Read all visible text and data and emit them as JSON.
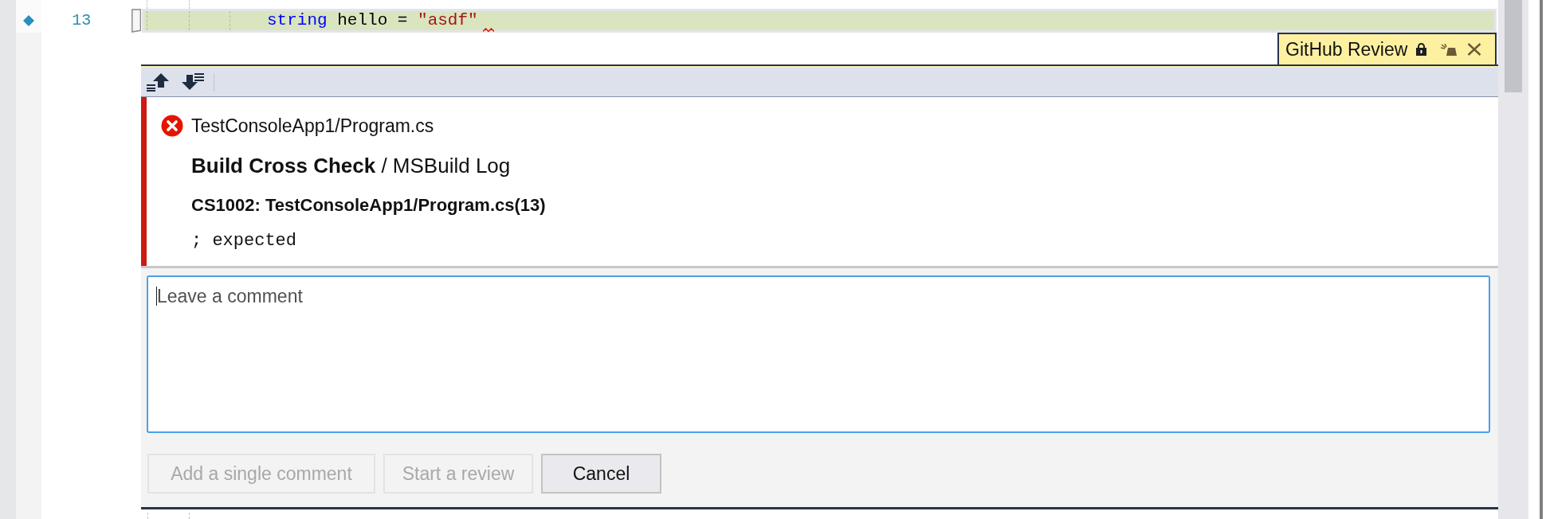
{
  "editor": {
    "lines": [
      {
        "number": "13",
        "highlighted": true,
        "marker": true,
        "error": true,
        "tokens": [
          {
            "kind": "keyword",
            "text": "string"
          },
          {
            "kind": "plain",
            "text": " hello = "
          },
          {
            "kind": "string",
            "text": "\"asdf\""
          }
        ]
      }
    ]
  },
  "peek_tab": {
    "title": "GitHub Review"
  },
  "annotation": {
    "kind": "error",
    "path": "TestConsoleApp1/Program.cs",
    "title": "**Build Cross Check** / MSBuild Log",
    "code": "CS1002: TestConsoleApp1/Program.cs(13)",
    "message": "; expected"
  },
  "comment_field": {
    "placeholder": "Leave a comment"
  },
  "buttons": [
    {
      "label": "Add a single comment",
      "disabled": true
    },
    {
      "label": "Start a review",
      "disabled": true
    },
    {
      "label": "Cancel",
      "disabled": false
    }
  ]
}
